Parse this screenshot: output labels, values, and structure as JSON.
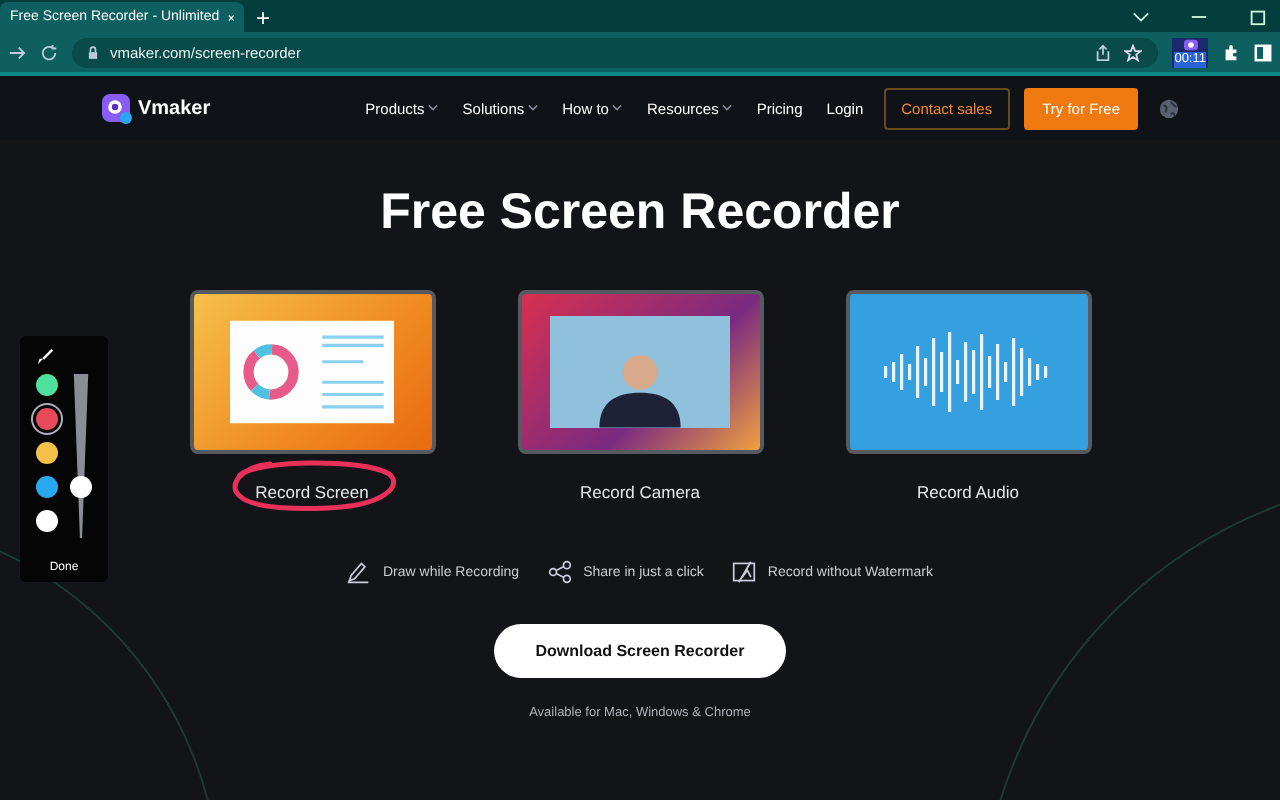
{
  "browser": {
    "tab_title": "Free Screen Recorder - Unlimited",
    "new_tab": "+",
    "url": "vmaker.com/screen-recorder",
    "timer": "00:11"
  },
  "nav": {
    "brand": "Vmaker",
    "items": [
      {
        "label": "Products",
        "dropdown": true
      },
      {
        "label": "Solutions",
        "dropdown": true
      },
      {
        "label": "How to",
        "dropdown": true
      },
      {
        "label": "Resources",
        "dropdown": true
      },
      {
        "label": "Pricing",
        "dropdown": false
      },
      {
        "label": "Login",
        "dropdown": false
      }
    ],
    "contact": "Contact sales",
    "try": "Try for Free"
  },
  "hero": {
    "title": "Free Screen Recorder",
    "cards": [
      {
        "kind": "screen",
        "label": "Record Screen",
        "annotated": true
      },
      {
        "kind": "camera",
        "label": "Record Camera",
        "annotated": false
      },
      {
        "kind": "audio",
        "label": "Record Audio",
        "annotated": false
      }
    ],
    "features": [
      {
        "kind": "draw",
        "label": "Draw while Recording"
      },
      {
        "kind": "share",
        "label": "Share in just a click"
      },
      {
        "kind": "watermark",
        "label": "Record without Watermark"
      }
    ],
    "download": "Download Screen Recorder",
    "note": "Available for Mac, Windows & Chrome"
  },
  "draw_toolbar": {
    "colors": [
      {
        "color": "#4fe0a0",
        "selected": false
      },
      {
        "color": "#e84a5a",
        "selected": true
      },
      {
        "color": "#f5c04a",
        "selected": false
      },
      {
        "color": "#29a8f0",
        "selected": false
      },
      {
        "color": "#ffffff",
        "selected": false
      }
    ],
    "size": {
      "level": 0.3
    },
    "done": "Done"
  }
}
